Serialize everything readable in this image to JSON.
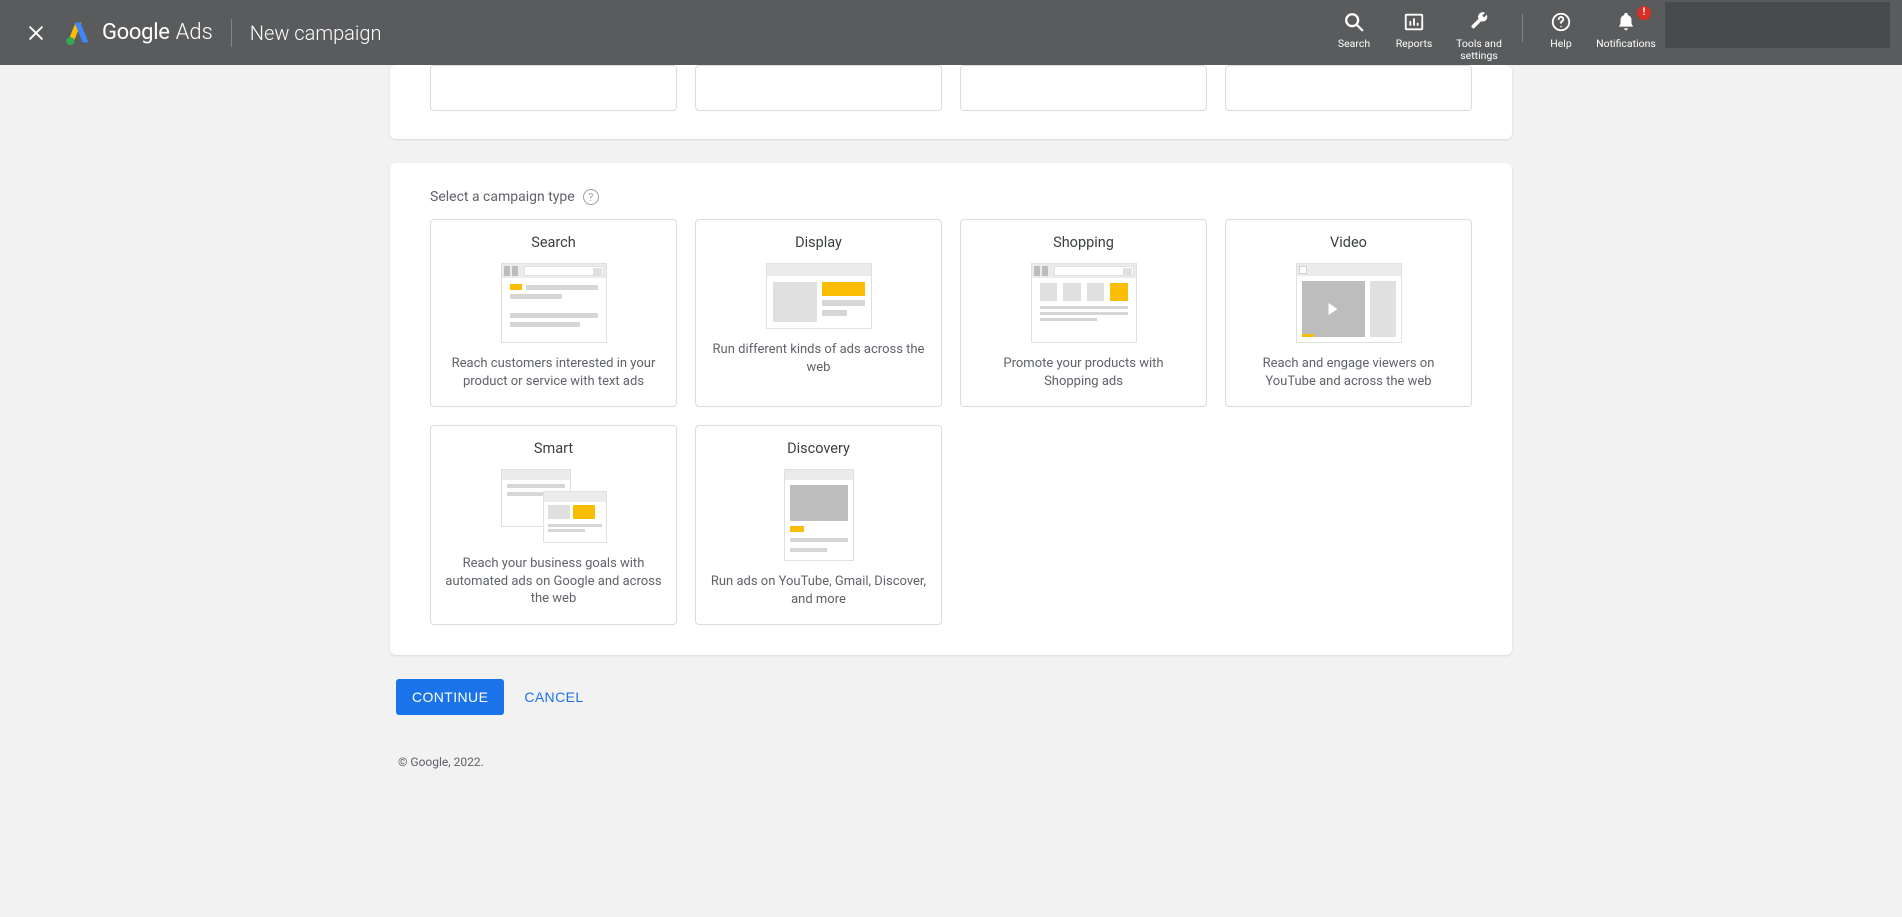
{
  "header": {
    "logo_google": "Google",
    "logo_ads": "Ads",
    "page_title": "New campaign",
    "icons": {
      "search": "Search",
      "reports": "Reports",
      "tools": "Tools and settings",
      "help": "Help",
      "notifications": "Notifications",
      "notif_badge": "!"
    }
  },
  "section": {
    "title": "Select a campaign type"
  },
  "cards": {
    "search": {
      "title": "Search",
      "desc": "Reach customers interested in your product or service with text ads"
    },
    "display": {
      "title": "Display",
      "desc": "Run different kinds of ads across the web"
    },
    "shopping": {
      "title": "Shopping",
      "desc": "Promote your products with Shopping ads"
    },
    "video": {
      "title": "Video",
      "desc": "Reach and engage viewers on YouTube and across the web"
    },
    "smart": {
      "title": "Smart",
      "desc": "Reach your business goals with automated ads on Google and across the web"
    },
    "discovery": {
      "title": "Discovery",
      "desc": "Run ads on YouTube, Gmail, Discover, and more"
    }
  },
  "actions": {
    "continue": "CONTINUE",
    "cancel": "CANCEL"
  },
  "footer": {
    "copyright": "© Google, 2022."
  }
}
